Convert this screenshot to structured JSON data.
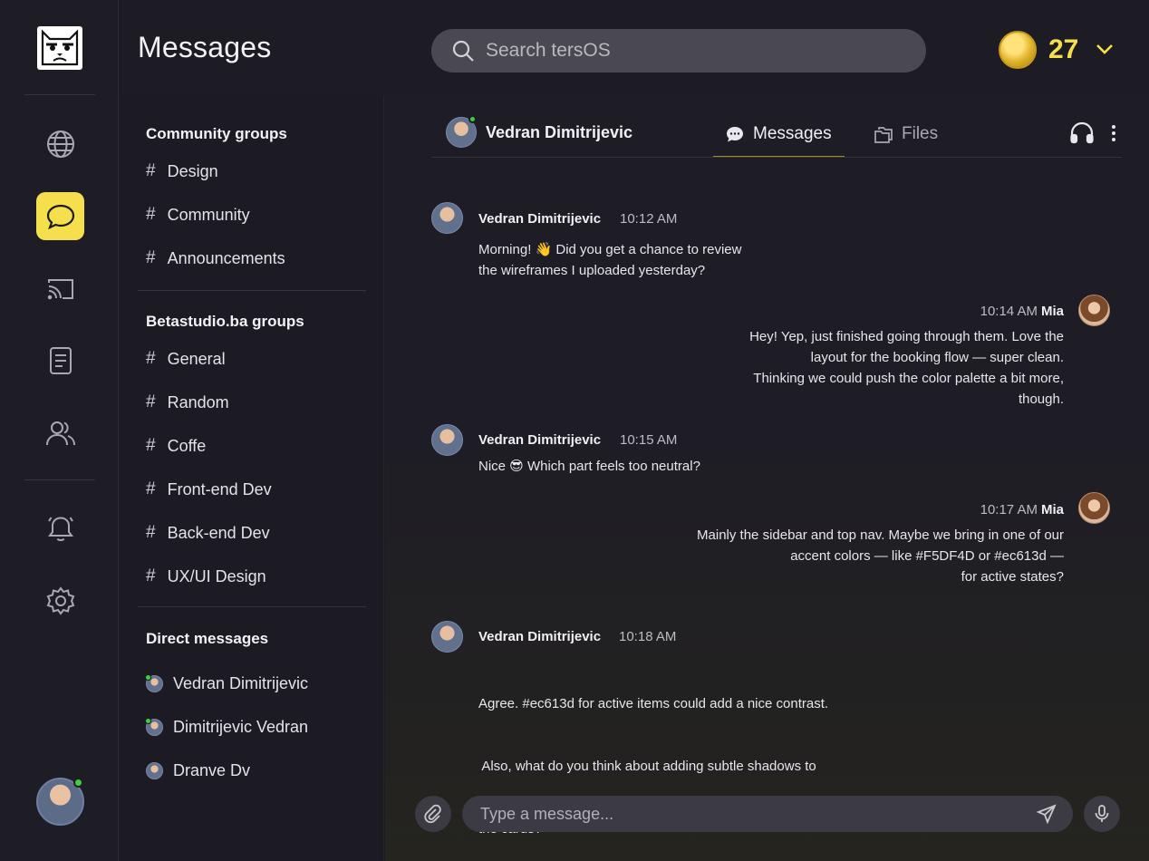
{
  "app": {
    "title": "Messages"
  },
  "search": {
    "placeholder": "Search tersOS"
  },
  "coins": {
    "count": "27"
  },
  "rail": {
    "items": [
      {
        "icon": "globe-icon",
        "active": false
      },
      {
        "icon": "chat-bubble-icon",
        "active": true
      },
      {
        "icon": "cast-icon",
        "active": false
      },
      {
        "icon": "document-icon",
        "active": false
      },
      {
        "icon": "users-icon",
        "active": false
      },
      {
        "icon": "bell-icon",
        "active": false
      },
      {
        "icon": "gear-icon",
        "active": false
      }
    ]
  },
  "sidebar": {
    "community": {
      "title": "Community groups",
      "items": [
        "Design",
        "Community",
        "Announcements"
      ]
    },
    "betastudio": {
      "title": "Betastudio.ba groups",
      "items": [
        "General",
        "Random",
        "Coffe",
        "Front-end Dev",
        "Back-end Dev",
        "UX/UI Design"
      ]
    },
    "direct": {
      "title": "Direct messages",
      "items": [
        "Vedran Dimitrijevic",
        "Dimitrijevic Vedran",
        "Dranve Dv"
      ]
    }
  },
  "chat": {
    "contact_name": "Vedran Dimitrijevic",
    "tabs": {
      "messages": "Messages",
      "files": "Files"
    },
    "messages": [
      {
        "sender": "Vedran Dimitrijevic",
        "time": "10:12 AM",
        "lines": [
          "Morning! 👋 Did you get a chance to review",
          "the wireframes I uploaded yesterday?"
        ]
      },
      {
        "sender": "Mia",
        "time": "10:14 AM",
        "lines": [
          "Hey! Yep, just finished going through them. Love the",
          "layout for the booking flow — super clean.",
          "Thinking we could push the color palette a bit more,",
          "though."
        ]
      },
      {
        "sender": "Vedran Dimitrijevic",
        "time": "10:15 AM",
        "lines": [
          "Nice 😎 Which part feels too neutral?"
        ]
      },
      {
        "sender": "Mia",
        "time": "10:17 AM",
        "lines": [
          "Mainly the sidebar and top nav. Maybe we bring in one of our",
          "accent colors — like #F5DF4D or #ec613d —",
          "for active states?"
        ]
      },
      {
        "sender": "Vedran Dimitrijevic",
        "time": "10:18 AM",
        "lines": [
          "Agree. #ec613d for active items could add a nice contrast.",
          " Also, what do you think about adding subtle shadows to",
          "the cards?"
        ]
      }
    ]
  },
  "composer": {
    "placeholder": "Type a message..."
  },
  "colors": {
    "accent_yellow": "#F5DF4D",
    "accent_orange": "#ec613d",
    "online": "#3bd13b"
  }
}
